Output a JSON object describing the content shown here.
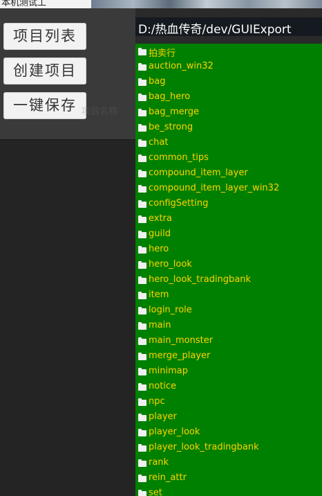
{
  "window": {
    "title_fragment": "本机测试工"
  },
  "left_panel": {
    "buttons": {
      "project_list": "项目列表",
      "create_project": "创建项目",
      "save_all": "一键保存"
    },
    "ghost_text": "项目名称"
  },
  "right_panel": {
    "path": "D:/热血传奇/dev/GUIExport",
    "folders": [
      "拍卖行",
      "auction_win32",
      "bag",
      "bag_hero",
      "bag_merge",
      "be_strong",
      "chat",
      "common_tips",
      "compound_item_layer",
      "compound_item_layer_win32",
      "configSetting",
      "extra",
      "guild",
      "hero",
      "hero_look",
      "hero_look_tradingbank",
      "item",
      "login_role",
      "main",
      "main_monster",
      "merge_player",
      "minimap",
      "notice",
      "npc",
      "player",
      "player_look",
      "player_look_tradingbank",
      "rank",
      "rein_attr",
      "set"
    ]
  },
  "colors": {
    "list_background": "#008000",
    "folder_text": "#ffd200",
    "path_background": "#151a20",
    "button_background": "#f2f2f2"
  }
}
